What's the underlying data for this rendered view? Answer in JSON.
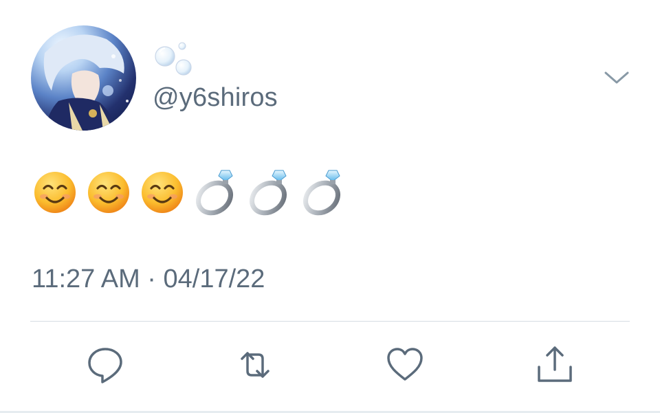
{
  "tweet": {
    "display_name": "🫧",
    "handle": "@y6shiros",
    "text_emojis": [
      "smiling-face-with-smiling-eyes",
      "smiling-face-with-smiling-eyes",
      "smiling-face-with-smiling-eyes",
      "ring",
      "ring",
      "ring"
    ],
    "timestamp": "11:27 AM · 04/17/22"
  },
  "icons": {
    "caret": "chevron-down-icon",
    "reply": "reply-icon",
    "retweet": "retweet-icon",
    "like": "heart-icon",
    "share": "share-icon"
  },
  "colors": {
    "secondary_text": "#5b6b7b",
    "icon": "#5b6b7b",
    "divider": "#d6dde3"
  }
}
